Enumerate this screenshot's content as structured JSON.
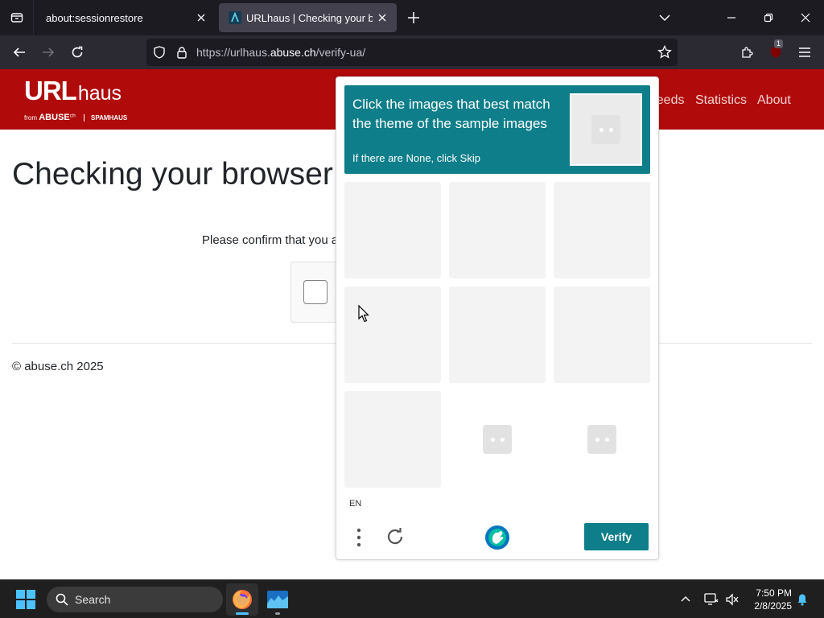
{
  "browser": {
    "tabs": [
      {
        "title": "about:sessionrestore"
      },
      {
        "title": "URLhaus | Checking your browse"
      }
    ],
    "url_prefix": "https://urlhaus.",
    "url_domain": "abuse.ch",
    "url_path": "/verify-ua/",
    "extension_badge": "1"
  },
  "site": {
    "logo_main": "URL",
    "logo_sub": "haus",
    "logo_from": "from",
    "logo_abuse": "ABUSE",
    "logo_abuse_sup": "ch",
    "logo_spamhaus": "SPAMHAUS",
    "nav": [
      "Feeds",
      "Statistics",
      "About"
    ],
    "heading": "Checking your browser",
    "confirm_text": "Please confirm that you are human",
    "copyright": "© abuse.ch 2025"
  },
  "captcha": {
    "prompt": "Click the images that best match the theme of the sample images",
    "subprompt": "If there are None, click Skip",
    "language": "EN",
    "verify_label": "Verify"
  },
  "taskbar": {
    "search_label": "Search",
    "time": "7:50 PM",
    "date": "2/8/2025"
  },
  "colors": {
    "site_red": "#b00a0b",
    "captcha_teal": "#0d7e8a",
    "browser_dark": "#1c1b22",
    "browser_toolbar": "#2b2a33"
  }
}
